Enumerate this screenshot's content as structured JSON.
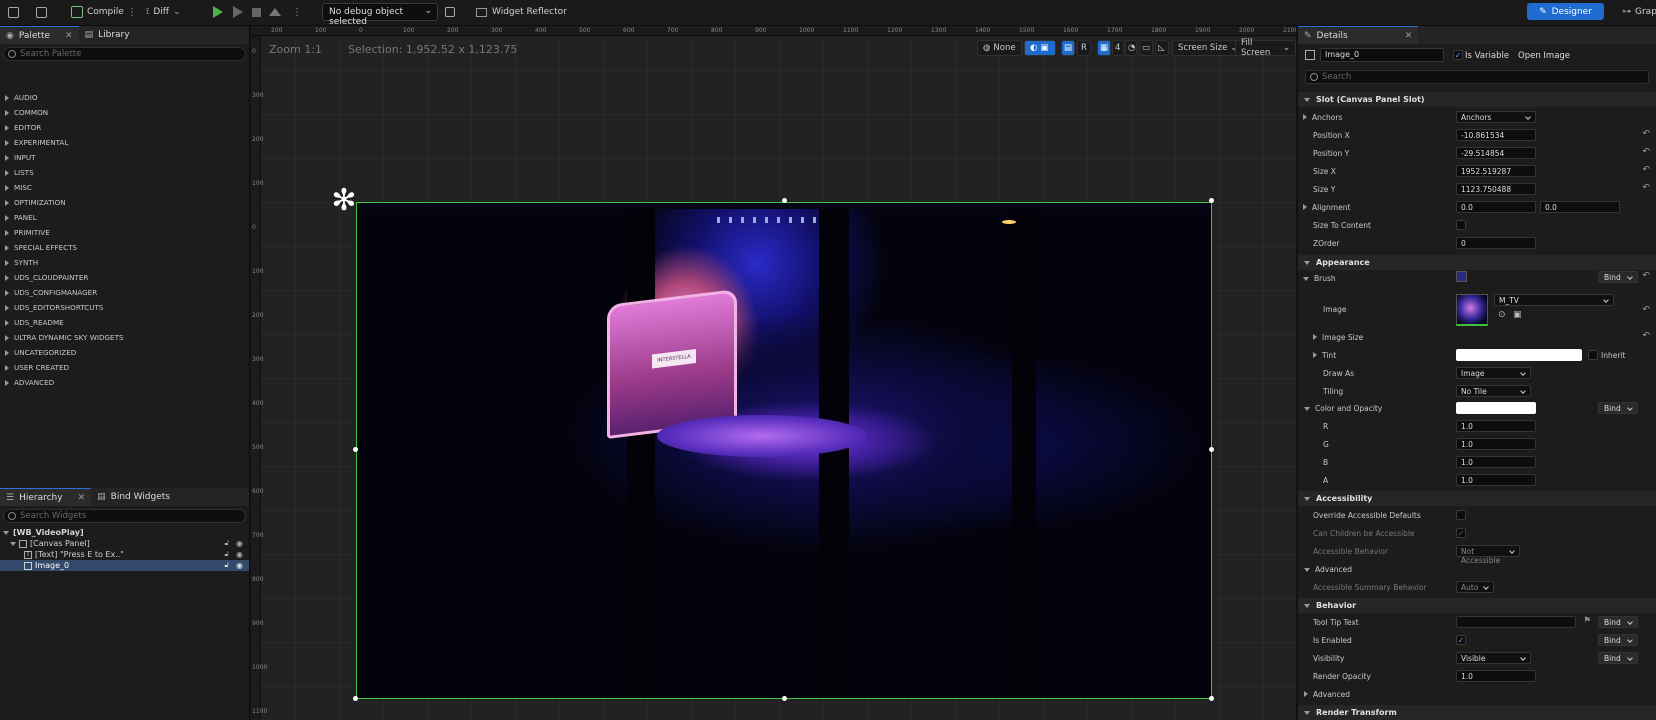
{
  "toolbar": {
    "compile_label": "Compile",
    "diff_label": "Diff",
    "debug_select": "No debug object selected",
    "widget_reflector_label": "Widget Reflector",
    "designer_label": "Designer",
    "graph_label": "Grap"
  },
  "palette": {
    "tab_label": "Palette",
    "library_label": "Library",
    "search_placeholder": "Search Palette",
    "categories": [
      "AUDIO",
      "COMMON",
      "EDITOR",
      "EXPERIMENTAL",
      "INPUT",
      "LISTS",
      "MISC",
      "OPTIMIZATION",
      "PANEL",
      "PRIMITIVE",
      "SPECIAL EFFECTS",
      "SYNTH",
      "UDS_CLOUDPAINTER",
      "UDS_CONFIGMANAGER",
      "UDS_EDITORSHORTCUTS",
      "UDS_README",
      "ULTRA DYNAMIC SKY WIDGETS",
      "UNCATEGORIZED",
      "USER CREATED",
      "ADVANCED"
    ]
  },
  "hierarchy": {
    "tab_label": "Hierarchy",
    "bind_label": "Bind Widgets",
    "search_placeholder": "Search Widgets",
    "root": "[WB_VideoPlay]",
    "canvas": "[Canvas Panel]",
    "text_item": "[Text] \"Press E to Ex..\"",
    "image_item": "Image_0"
  },
  "viewport": {
    "zoom": "Zoom 1:1",
    "selection": "Selection: 1,952.52 x 1,123.75",
    "none_label": "None",
    "r_label": "R",
    "grid_num": "4",
    "screen_size": "Screen Size",
    "fill_screen": "Fill Screen",
    "ruler_h": [
      "200",
      "100",
      "0",
      "100",
      "200",
      "300",
      "400",
      "500",
      "600",
      "700",
      "800",
      "900",
      "1000",
      "1100",
      "1200",
      "1300",
      "1400",
      "1500",
      "1600",
      "1700",
      "1800",
      "1900",
      "2000",
      "2100"
    ],
    "ruler_v": [
      "0",
      "300",
      "200",
      "100",
      "0",
      "100",
      "200",
      "300",
      "400",
      "500",
      "600",
      "700",
      "800",
      "900",
      "1000",
      "1100"
    ],
    "stage_sign": "INTERSTELLA"
  },
  "details": {
    "tab_label": "Details",
    "name_value": "Image_0",
    "is_variable_label": "Is Variable",
    "open_image_label": "Open Image",
    "search_placeholder": "Search",
    "slot_header": "Slot (Canvas Panel Slot)",
    "anchors_label": "Anchors",
    "anchors_value": "Anchors",
    "pos_x_label": "Position X",
    "pos_x": "-10.861534",
    "pos_y_label": "Position Y",
    "pos_y": "-29.514854",
    "size_x_label": "Size X",
    "size_x": "1952.519287",
    "size_y_label": "Size Y",
    "size_y": "1123.750488",
    "alignment_label": "Alignment",
    "align_x": "0.0",
    "align_y": "0.0",
    "size_to_content_label": "Size To Content",
    "zorder_label": "ZOrder",
    "zorder": "0",
    "appearance_header": "Appearance",
    "brush_label": "Brush",
    "bind": "Bind",
    "image_label": "Image",
    "image_value": "M_TV",
    "image_size_label": "Image Size",
    "tint_label": "Tint",
    "inherit_label": "Inherit",
    "draw_as_label": "Draw As",
    "draw_as": "Image",
    "tiling_label": "Tiling",
    "tiling": "No Tile",
    "color_opacity_label": "Color and Opacity",
    "r_label": "R",
    "r": "1.0",
    "g_label": "G",
    "g": "1.0",
    "b_label": "B",
    "b": "1.0",
    "a_label": "A",
    "a": "1.0",
    "accessibility_header": "Accessibility",
    "override_label": "Override Accessible Defaults",
    "children_label": "Can Children be Accessible",
    "acc_behavior_label": "Accessible Behavior",
    "acc_behavior": "Not Accessible",
    "advanced_label": "Advanced",
    "summary_label": "Accessible Summary Behavior",
    "summary": "Auto",
    "behavior_header": "Behavior",
    "tooltip_label": "Tool Tip Text",
    "enabled_label": "Is Enabled",
    "visibility_label": "Visibility",
    "visibility": "Visible",
    "render_opacity_label": "Render Opacity",
    "render_opacity": "1.0",
    "advanced2_label": "Advanced",
    "render_transform_header": "Render Transform"
  }
}
